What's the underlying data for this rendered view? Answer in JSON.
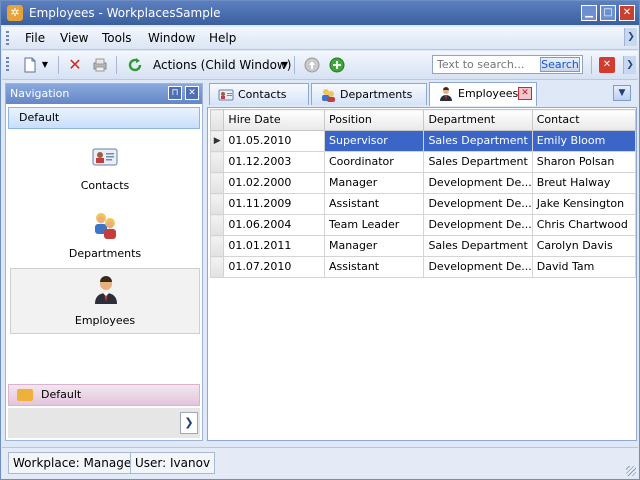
{
  "window": {
    "title": "Employees - WorkplacesSample"
  },
  "menu": [
    "File",
    "View",
    "Tools",
    "Window",
    "Help"
  ],
  "toolbar": {
    "actions_label": "Actions (Child Window)",
    "search_placeholder": "Text to search...",
    "search_button": "Search"
  },
  "navigation": {
    "title": "Navigation",
    "group": "Default",
    "items": [
      {
        "label": "Contacts"
      },
      {
        "label": "Departments"
      },
      {
        "label": "Employees"
      }
    ],
    "bottom_group": "Default"
  },
  "tabs": [
    {
      "label": "Contacts"
    },
    {
      "label": "Departments"
    },
    {
      "label": "Employees",
      "active": true
    }
  ],
  "grid": {
    "columns": [
      "Hire Date",
      "Position",
      "Department",
      "Contact"
    ],
    "rows": [
      [
        "01.05.2010",
        "Supervisor",
        "Sales Department",
        "Emily Bloom"
      ],
      [
        "01.12.2003",
        "Coordinator",
        "Sales Department",
        "Sharon Polsan"
      ],
      [
        "01.02.2000",
        "Manager",
        "Development De...",
        "Breut Halway"
      ],
      [
        "01.11.2009",
        "Assistant",
        "Development De...",
        "Jake Kensington"
      ],
      [
        "01.06.2004",
        "Team Leader",
        "Development De...",
        "Chris Chartwood"
      ],
      [
        "01.01.2011",
        "Manager",
        "Sales Department",
        "Carolyn Davis"
      ],
      [
        "01.07.2010",
        "Assistant",
        "Development De...",
        "David Tam"
      ]
    ],
    "selected_row": 0
  },
  "status": {
    "workplace": "Workplace: Manager",
    "user": "User: Ivanov"
  },
  "colors": {
    "selection": "#3b66c8",
    "titlebar": "#4a6fb0",
    "close": "#c8412e"
  }
}
